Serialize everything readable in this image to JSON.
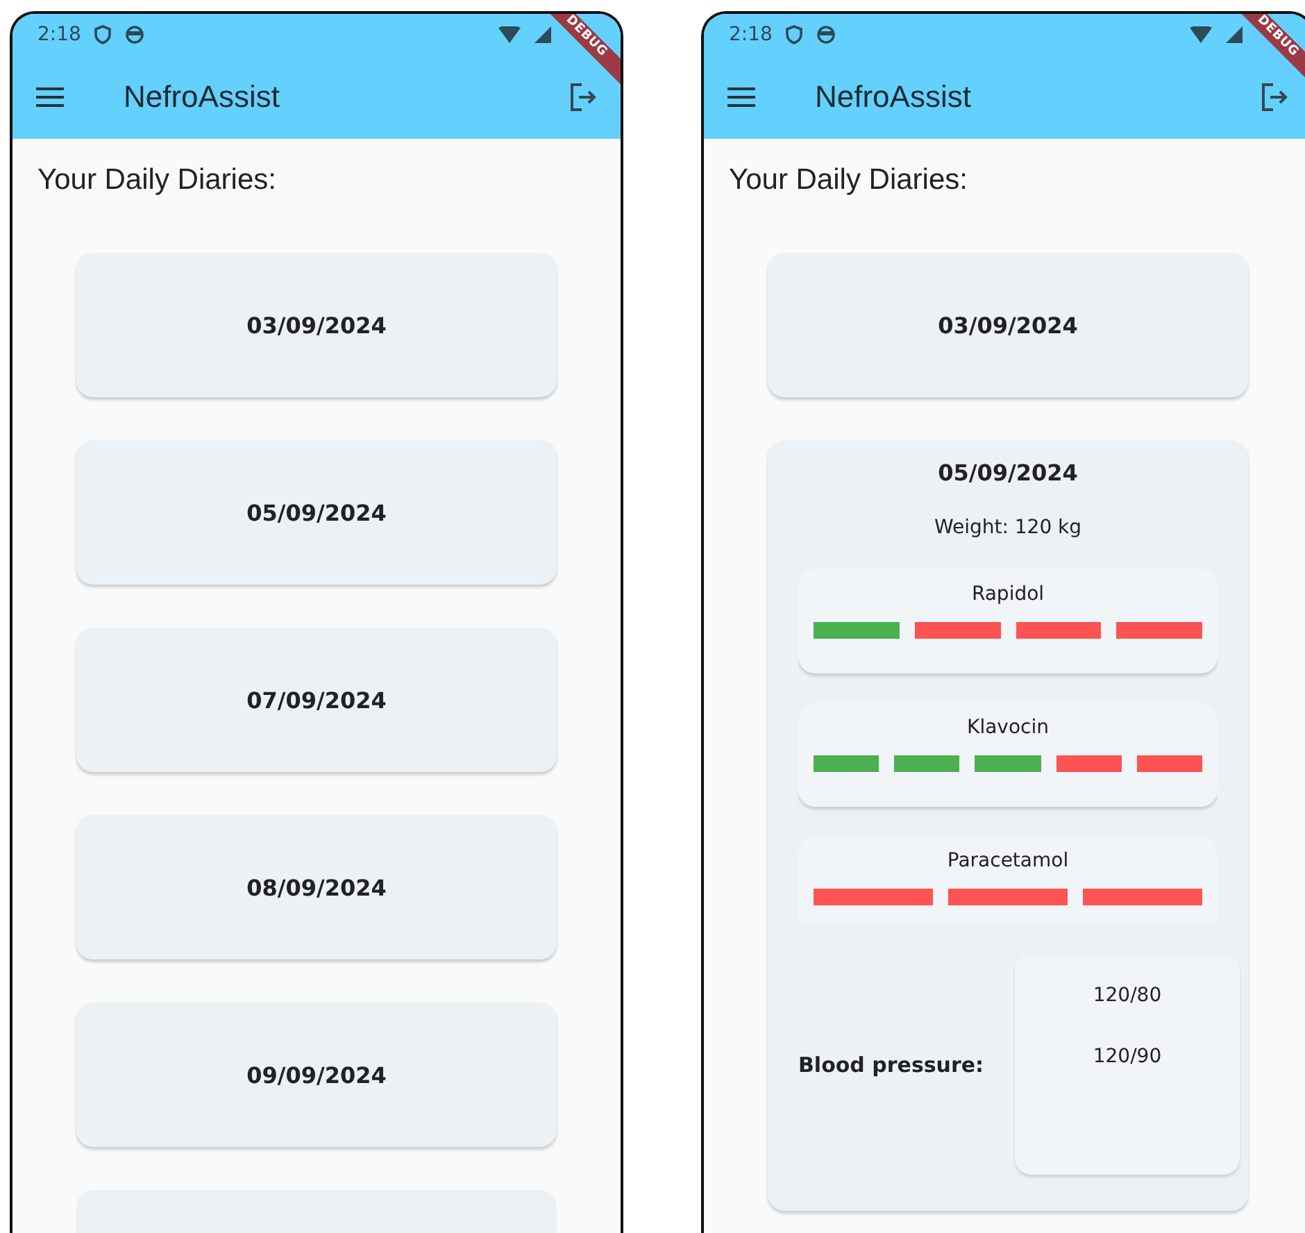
{
  "screens": [
    {
      "status_bar": {
        "time": "2:18"
      },
      "debug_banner": "DEBUG",
      "app_bar": {
        "title": "NefroAssist"
      },
      "heading": "Your Daily Diaries:",
      "more_below": true,
      "diaries": [
        {
          "date": "03/09/2024",
          "expanded": false
        },
        {
          "date": "05/09/2024",
          "expanded": false
        },
        {
          "date": "07/09/2024",
          "expanded": false
        },
        {
          "date": "08/09/2024",
          "expanded": false
        },
        {
          "date": "09/09/2024",
          "expanded": false
        }
      ]
    },
    {
      "status_bar": {
        "time": "2:18"
      },
      "debug_banner": "DEBUG",
      "app_bar": {
        "title": "NefroAssist"
      },
      "heading": "Your Daily Diaries:",
      "diaries": [
        {
          "date": "03/09/2024",
          "expanded": false
        },
        {
          "date": "05/09/2024",
          "expanded": true,
          "weight": "Weight: 120 kg",
          "medications": [
            {
              "name": "Rapidol",
              "doses": [
                {
                  "taken": true
                },
                {
                  "taken": false
                },
                {
                  "taken": false
                },
                {
                  "taken": false
                }
              ]
            },
            {
              "name": "Klavocin",
              "doses": [
                {
                  "taken": true
                },
                {
                  "taken": true
                },
                {
                  "taken": true
                },
                {
                  "taken": false
                },
                {
                  "taken": false
                }
              ]
            },
            {
              "name": "Paracetamol",
              "doses": [
                {
                  "taken": false
                },
                {
                  "taken": false
                },
                {
                  "taken": false
                }
              ]
            }
          ],
          "blood_pressure": {
            "label": "Blood pressure:",
            "readings": [
              "120/80",
              "120/90"
            ]
          }
        }
      ]
    }
  ]
}
